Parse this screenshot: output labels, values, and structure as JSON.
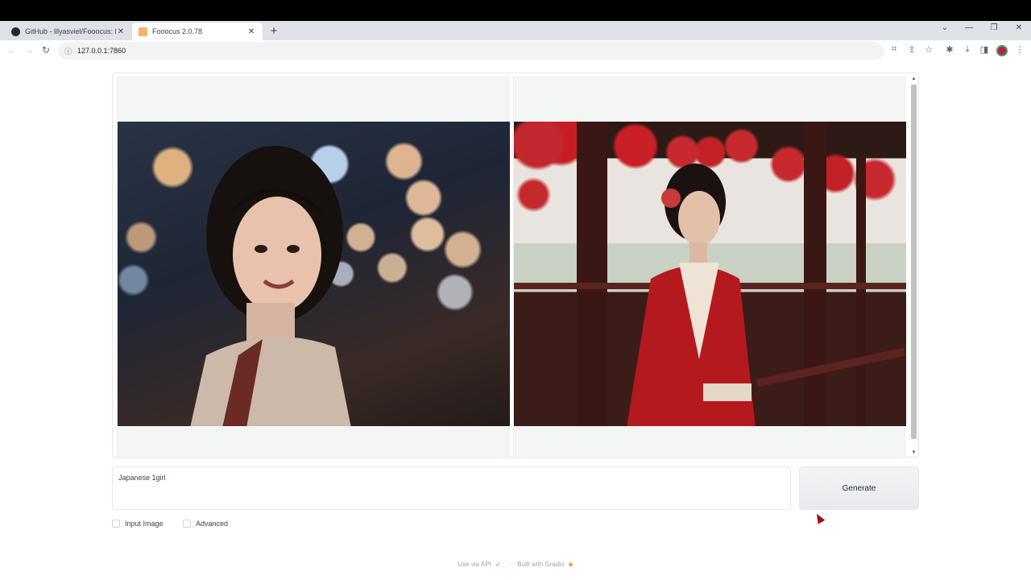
{
  "browser": {
    "tabs": [
      {
        "title": "GitHub - lllyasviel/Fooocus: Fooc",
        "icon": "github-icon",
        "active": false
      },
      {
        "title": "Fooocus 2.0.78",
        "icon": "fooocus-icon",
        "active": true
      }
    ],
    "new_tab_symbol": "+",
    "close_symbol": "✕",
    "url": "127.0.0.1:7860",
    "window_controls": [
      "⌄",
      "—",
      "❐",
      "✕"
    ]
  },
  "gallery": {
    "images": [
      {
        "alt": "Young woman with bokeh lights background"
      },
      {
        "alt": "Woman in red kimono with red lanterns"
      }
    ]
  },
  "prompt": {
    "value": "Japanese 1girl"
  },
  "generate": {
    "label": "Generate"
  },
  "options": {
    "input_image_label": "Input Image",
    "advanced_label": "Advanced"
  },
  "footer": {
    "api_label": "Use via API",
    "separator": "·",
    "built_label": "Built with Gradio"
  }
}
